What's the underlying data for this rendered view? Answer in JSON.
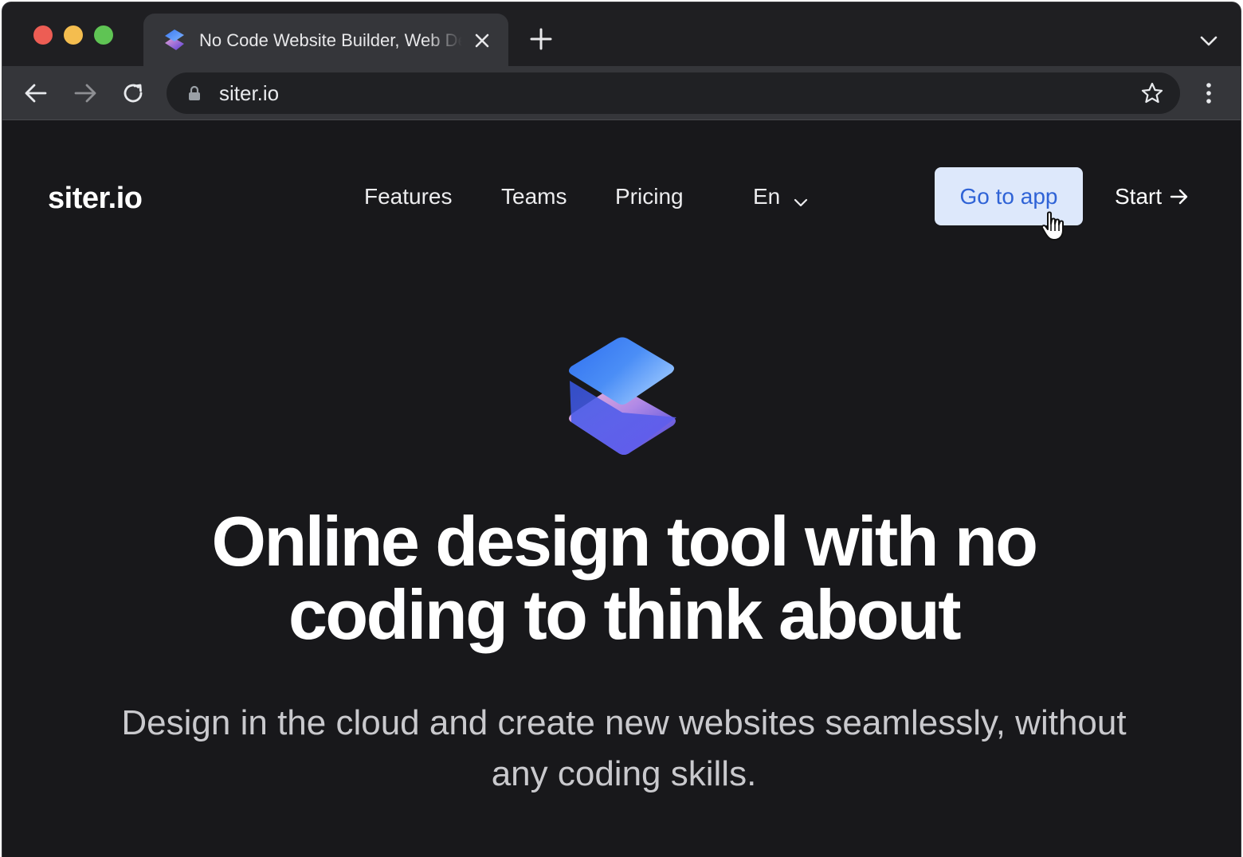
{
  "browser": {
    "tab": {
      "title": "No Code Website Builder, Web Design Tool",
      "favicon": "siter-logo-icon"
    },
    "address_bar": {
      "url": "siter.io",
      "security_icon": "lock-icon"
    },
    "icons": {
      "back": "arrow-left-icon",
      "forward": "arrow-right-icon",
      "reload": "reload-icon",
      "bookmark": "star-icon",
      "menu": "kebab-icon",
      "new_tab": "plus-icon",
      "tab_close": "close-icon",
      "tab_search": "chevron-down-icon"
    },
    "traffic_lights": [
      "#ed5d54",
      "#f4bd4f",
      "#5fc454"
    ]
  },
  "header": {
    "logo": "siter.io",
    "nav": [
      {
        "label": "Features"
      },
      {
        "label": "Teams"
      },
      {
        "label": "Pricing"
      }
    ],
    "language": {
      "label": "En",
      "icon": "chevron-down-icon"
    },
    "go_to_app": "Go to app",
    "start": "Start",
    "start_icon": "arrow-right-icon"
  },
  "hero": {
    "logo_icon": "siter-logo-icon",
    "headline": "Online design tool with no coding to think about",
    "subheadline": "Design in the cloud and create new websites seamlessly, without any coding skills."
  },
  "colors": {
    "page_background": "#18181b",
    "cta_background": "#dde8fb",
    "cta_text": "#2f63d6",
    "text": "#ffffff",
    "muted_text": "#c9c9cd"
  }
}
